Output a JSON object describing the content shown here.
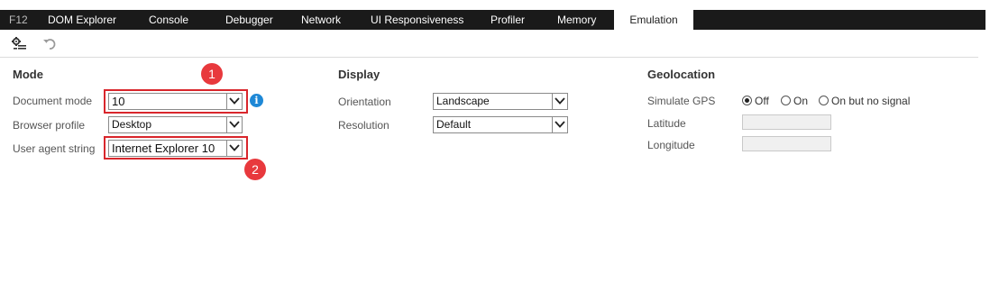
{
  "tabs": {
    "f12": "F12",
    "dom_explorer": "DOM Explorer",
    "console": "Console",
    "debugger": "Debugger",
    "network": "Network",
    "ui_responsiveness": "UI Responsiveness",
    "profiler": "Profiler",
    "memory": "Memory",
    "emulation": "Emulation"
  },
  "mode": {
    "title": "Mode",
    "document_mode_label": "Document mode",
    "document_mode_value": "10",
    "browser_profile_label": "Browser profile",
    "browser_profile_value": "Desktop",
    "user_agent_label": "User agent string",
    "user_agent_value": "Internet Explorer 10"
  },
  "display": {
    "title": "Display",
    "orientation_label": "Orientation",
    "orientation_value": "Landscape",
    "resolution_label": "Resolution",
    "resolution_value": "Default"
  },
  "geolocation": {
    "title": "Geolocation",
    "simulate_gps_label": "Simulate GPS",
    "options": [
      "Off",
      "On",
      "On but no signal"
    ],
    "selected": "Off",
    "latitude_label": "Latitude",
    "longitude_label": "Longitude"
  },
  "annotations": {
    "badge_1": "1",
    "badge_2": "2",
    "info": "i"
  },
  "colors": {
    "tabbar": "#1a1a1a",
    "highlight": "#d9262c",
    "badge": "#e8393d",
    "info": "#1e88d6"
  }
}
